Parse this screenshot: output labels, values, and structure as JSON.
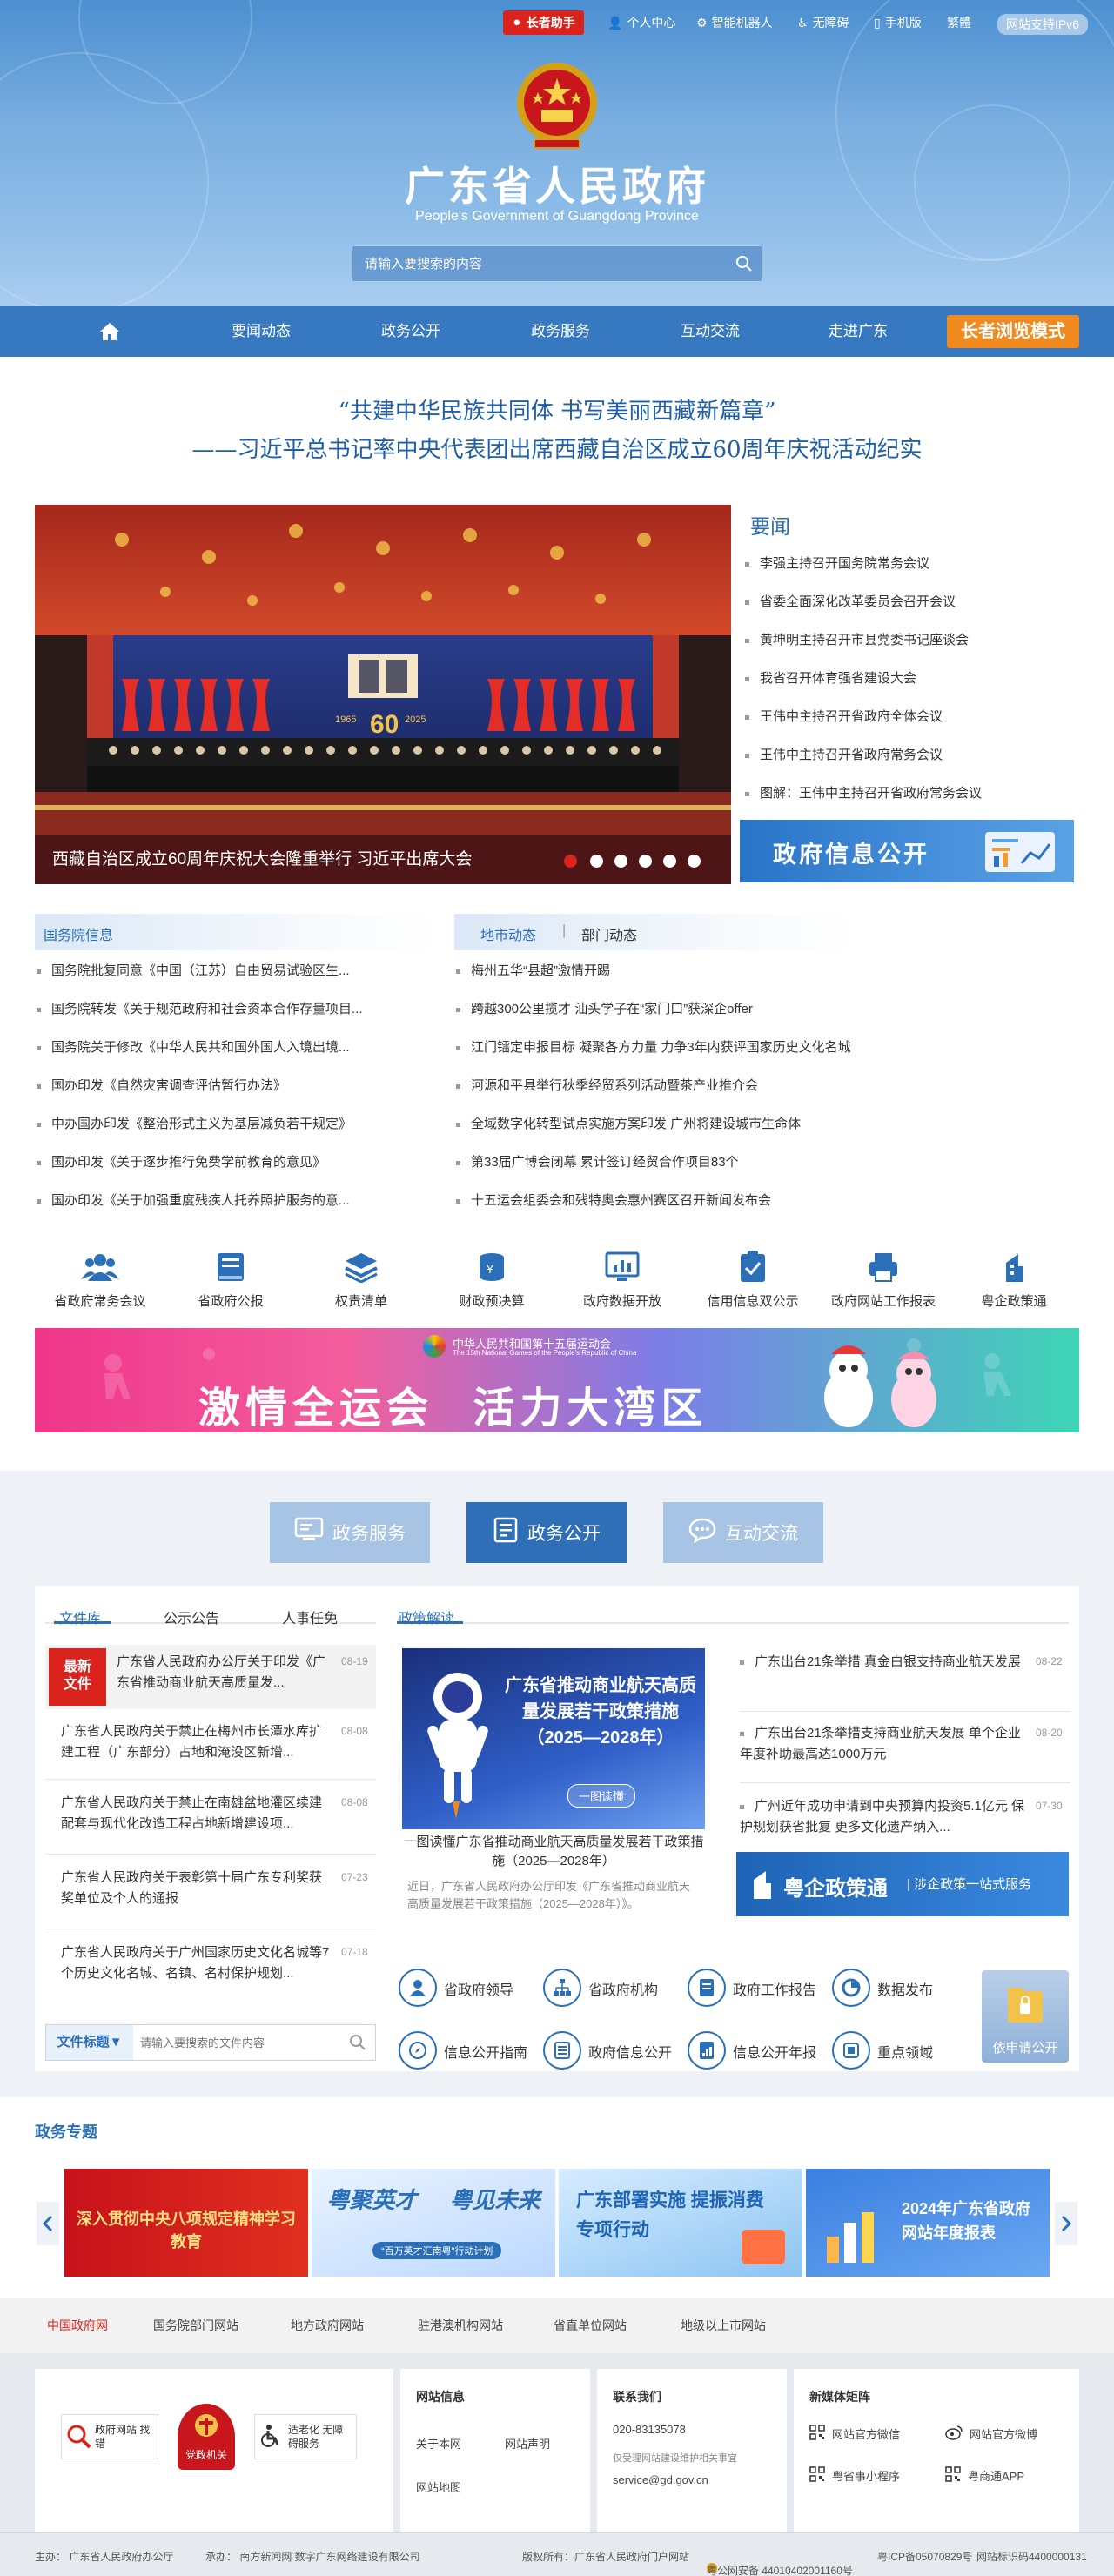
{
  "topbar": {
    "elder_assistant": "长者助手",
    "personal_center": "个人中心",
    "robot": "智能机器人",
    "accessibility": "无障碍",
    "mobile": "手机版",
    "traditional": "繁體",
    "ipv6": "网站支持IPv6"
  },
  "header": {
    "title": "广东省人民政府",
    "subtitle": "People's Government of Guangdong Province",
    "search_placeholder": "请输入要搜索的内容"
  },
  "nav": {
    "items": [
      "要闻动态",
      "政务公开",
      "政务服务",
      "互动交流",
      "走进广东"
    ],
    "elder_mode": "长者浏览模式"
  },
  "headline": {
    "line1": "“共建中华民族共同体  书写美丽西藏新篇章”",
    "line2": "——习近平总书记率中央代表团出席西藏自治区成立60周年庆祝活动纪实"
  },
  "photo": {
    "caption": "西藏自治区成立60周年庆祝大会隆重举行 习近平出席大会",
    "banner_left": "1965",
    "banner_right": "2025",
    "banner_mark": "60"
  },
  "news": {
    "title": "要闻",
    "items": [
      "李强主持召开国务院常务会议",
      "省委全面深化改革委员会召开会议",
      "黄坤明主持召开市县党委书记座谈会",
      "我省召开体育强省建设大会",
      "王伟中主持召开省政府全体会议",
      "王伟中主持召开省政府常务会议",
      "图解：王伟中主持召开省政府常务会议"
    ],
    "gov_info_banner": "政府信息公开"
  },
  "state_council": {
    "tab": "国务院信息",
    "items": [
      "国务院批复同意《中国（江苏）自由贸易试验区生...",
      "国务院转发《关于规范政府和社会资本合作存量项目...",
      "国务院关于修改《中华人民共和国外国人入境出境...",
      "国办印发《自然灾害调查评估暂行办法》",
      "中办国办印发《整治形式主义为基层减负若干规定》",
      "国办印发《关于逐步推行免费学前教育的意见》",
      "国办印发《关于加强重度残疾人托养照护服务的意..."
    ]
  },
  "local_news": {
    "tab_active": "地市动态",
    "tab_other": "部门动态",
    "items": [
      "梅州五华“县超”激情开踢",
      "跨越300公里揽才 汕头学子在“家门口”获深企offer",
      "江门镭定申报目标 凝聚各方力量 力争3年内获评国家历史文化名城",
      "河源和平县举行秋季经贸系列活动暨茶产业推介会",
      "全域数字化转型试点实施方案印发 广州将建设城市生命体",
      "第33届广博会闭幕 累计签订经贸合作项目83个",
      "十五运会组委会和残特奥会惠州赛区召开新闻发布会"
    ]
  },
  "services": [
    "省政府常务会议",
    "省政府公报",
    "权责清单",
    "财政预决算",
    "政府数据开放",
    "信用信息双公示",
    "政府网站工作报表",
    "粤企政策通"
  ],
  "games_banner": {
    "title_cn": "中华人民共和国第十五届运动会",
    "title_en": "The 15th National Games of the People's Republic of China",
    "slogan": "激情全运会  活力大湾区"
  },
  "big_tabs": [
    "政务服务",
    "政务公开",
    "互动交流"
  ],
  "files": {
    "tabs": [
      "文件库",
      "公示公告",
      "人事任免"
    ],
    "new_badge": "最新文件",
    "items": [
      {
        "text": "广东省人民政府办公厅关于印发《广东省推动商业航天高质量发...",
        "date": "08-19"
      },
      {
        "text": "广东省人民政府关于禁止在梅州市长潭水库扩建工程（广东部分）占地和淹没区新增...",
        "date": "08-08"
      },
      {
        "text": "广东省人民政府关于禁止在南雄盆地灌区续建配套与现代化改造工程占地新增建设项...",
        "date": "08-08"
      },
      {
        "text": "广东省人民政府关于表彰第十届广东专利奖获奖单位及个人的通报",
        "date": "07-23"
      },
      {
        "text": "广东省人民政府关于广州国家历史文化名城等7个历史文化名城、名镇、名村保护规划...",
        "date": "07-18"
      }
    ],
    "search_label": "文件标题▼",
    "search_placeholder": "请输入要搜索的文件内容"
  },
  "policy": {
    "tab": "政策解读",
    "poster_title": "广东省推动商业航天高质量发展若干政策措施（2025—2028年）",
    "poster_btn": "一图读懂",
    "caption": "一图读懂广东省推动商业航天高质量发展若干政策措施（2025—2028年）",
    "desc": "近日，广东省人民政府办公厅印发《广东省推动商业航天高质量发展若干政策措施（2025—2028年）》。",
    "items": [
      {
        "text": "广东出台21条举措 真金白银支持商业航天发展",
        "date": "08-22"
      },
      {
        "text": "广东出台21条举措支持商业航天发展 单个企业年度补助最高达1000万元",
        "date": "08-20"
      },
      {
        "text": "广州近年成功申请到中央预算内投资5.1亿元 保护规划获省批复 更多文化遗产纳入...",
        "date": "07-30"
      }
    ],
    "yqzct_title": "粤企政策通",
    "yqzct_sub": "涉企政策一站式服务"
  },
  "quick_links": [
    "省政府领导",
    "省政府机构",
    "政府工作报告",
    "数据发布",
    "信息公开指南",
    "政府信息公开",
    "信息公开年报",
    "重点领域"
  ],
  "apply_label": "依申请公开",
  "topics": {
    "title": "政务专题",
    "banners": [
      "深入贯彻中央八项规定精神学习教育",
      "粤聚英才 粤见未来",
      "广东部署实施 提振消费专项行动",
      "2024年广东省政府网站年度报表"
    ],
    "banner2_sub": "“百万英才汇南粤”行动计划"
  },
  "links_bar": [
    "中国政府网",
    "国务院部门网站",
    "地方政府网站",
    "驻港澳机构网站",
    "省直单位网站",
    "地级以上市网站"
  ],
  "footer": {
    "badge1": "政府网站 找错",
    "badge2": "党政机关",
    "badge3": "适老化 无障碍服务",
    "site_info_title": "网站信息",
    "site_links": [
      "关于本网",
      "网站声明",
      "网站地图"
    ],
    "contact_title": "联系我们",
    "phone": "020-83135078",
    "contact_note": "仅受理网站建设维护相关事宜",
    "email": "service@gd.gov.cn",
    "media_title": "新媒体矩阵",
    "media": [
      "网站官方微信",
      "网站官方微博",
      "粤省事小程序",
      "粤商通APP"
    ],
    "bottom": {
      "host": "主办：  广东省人民政府办公厅",
      "organizer": "承办：  南方新闻网  数字广东网络建设有限公司",
      "copyright": "版权所有：广东省人民政府门户网站",
      "police": "粤公网安备 44010402001160号",
      "icp": "粤ICP备05070829号",
      "code": "网站标识码4400000131"
    }
  },
  "colors": {
    "primary": "#3779c0",
    "accent_orange": "#f08a1e",
    "red": "#d9231c"
  }
}
